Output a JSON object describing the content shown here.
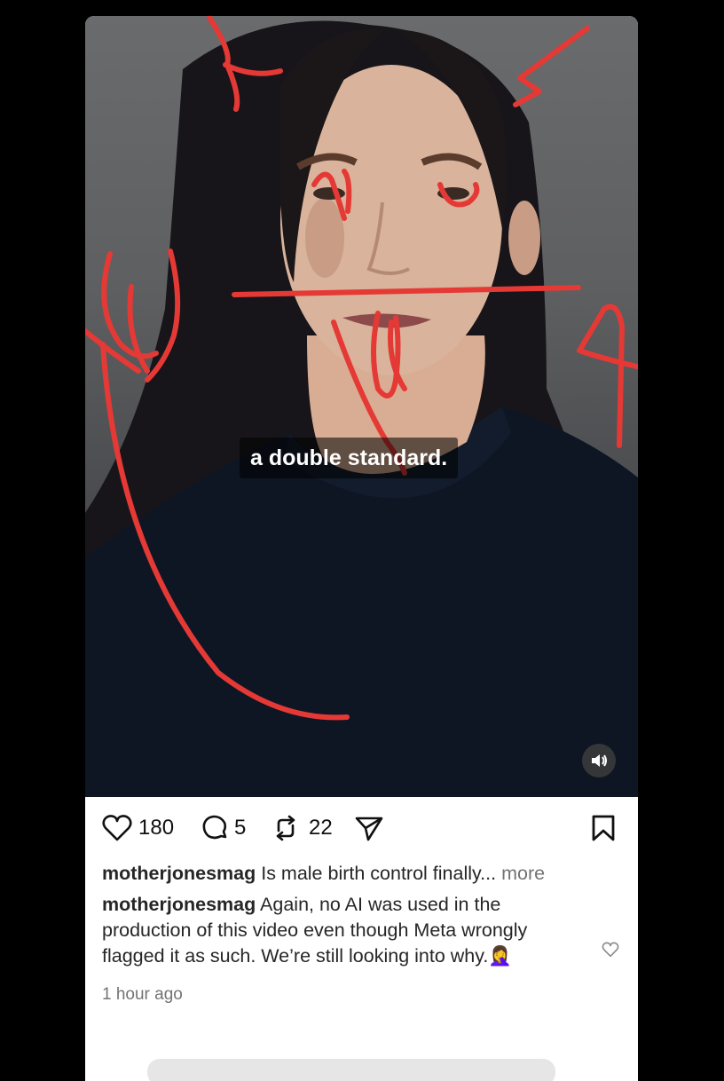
{
  "post": {
    "video_caption": "a double standard.",
    "likes": "180",
    "comments": "5",
    "reposts": "22"
  },
  "caption": {
    "username": "motherjonesmag",
    "text": "Is male birth control finally...",
    "more_label": "more"
  },
  "comment": {
    "username": "motherjonesmag",
    "text": "Again, no AI was used in the production of this video even though Meta wrongly flagged it as such. We’re still looking into why.",
    "emoji": "🤦‍♀️",
    "time": "1 hour ago"
  },
  "colors": {
    "annotation": "#e53935",
    "background": "#000000",
    "card": "#ffffff"
  },
  "icons": [
    "heart-icon",
    "comment-icon",
    "repost-icon",
    "share-icon",
    "bookmark-icon",
    "speaker-icon"
  ]
}
